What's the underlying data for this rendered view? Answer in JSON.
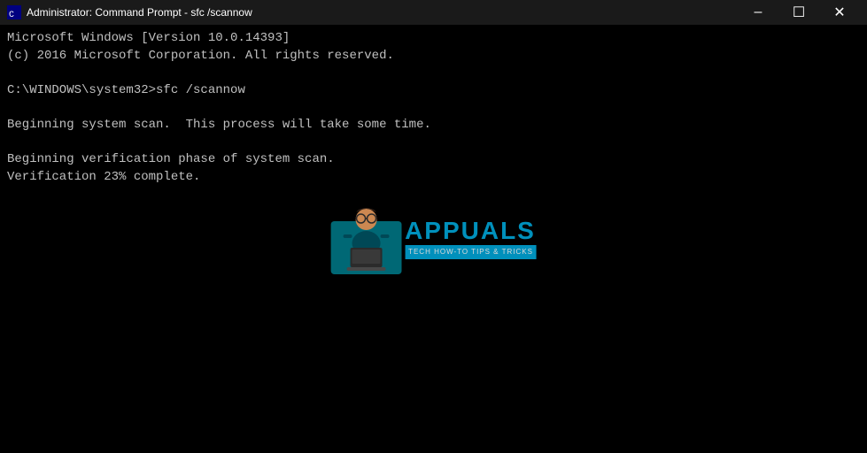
{
  "titleBar": {
    "icon": "cmd-icon",
    "title": "Administrator: Command Prompt - sfc  /scannow",
    "minimizeLabel": "–",
    "maximizeLabel": "☐",
    "closeLabel": "✕"
  },
  "terminal": {
    "lines": [
      "Microsoft Windows [Version 10.0.14393]",
      "(c) 2016 Microsoft Corporation. All rights reserved.",
      "",
      "C:\\WINDOWS\\system32>sfc /scannow",
      "",
      "Beginning system scan.  This process will take some time.",
      "",
      "Beginning verification phase of system scan.",
      "Verification 23% complete."
    ]
  },
  "watermark": {
    "appName": "APPUALS",
    "tagline": "TECH HOW-TO TIPS & TRICKS"
  }
}
